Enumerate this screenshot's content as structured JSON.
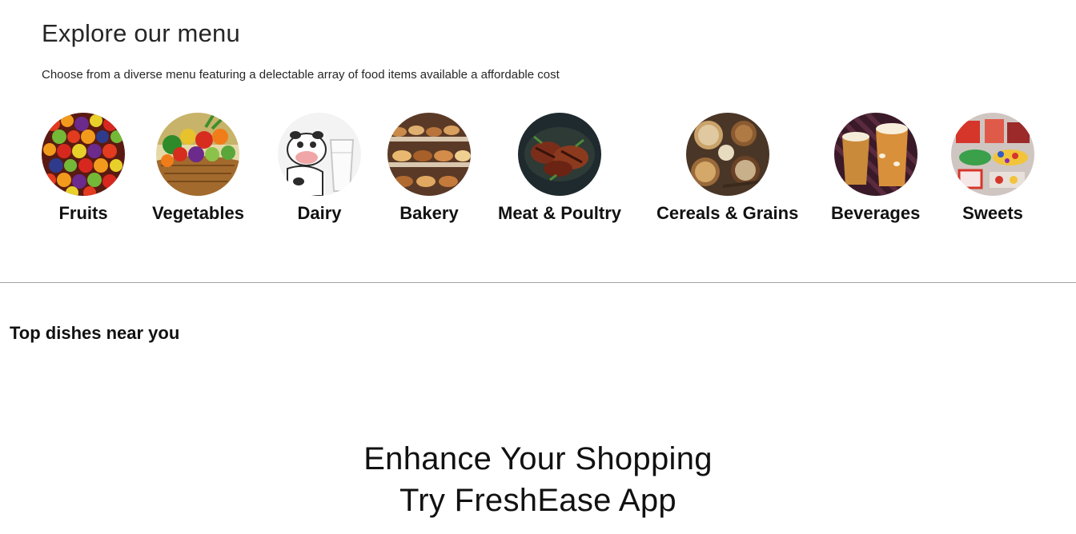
{
  "explore": {
    "title": "Explore our menu",
    "subtitle": "Choose from a diverse menu featuring a delectable array of food items available a affordable cost"
  },
  "categories": [
    {
      "label": "Fruits",
      "image": "fruits-image"
    },
    {
      "label": "Vegetables",
      "image": "vegetables-image"
    },
    {
      "label": "Dairy",
      "image": "dairy-image"
    },
    {
      "label": "Bakery",
      "image": "bakery-image"
    },
    {
      "label": "Meat & Poultry",
      "image": "meat-image"
    },
    {
      "label": "Cereals & Grains",
      "image": "grains-image"
    },
    {
      "label": "Beverages",
      "image": "beverages-image"
    },
    {
      "label": "Sweets",
      "image": "sweets-image"
    }
  ],
  "top_dishes": {
    "title": "Top dishes near you"
  },
  "promo": {
    "line1": "Enhance Your Shopping",
    "line2": "Try FreshEase App"
  }
}
